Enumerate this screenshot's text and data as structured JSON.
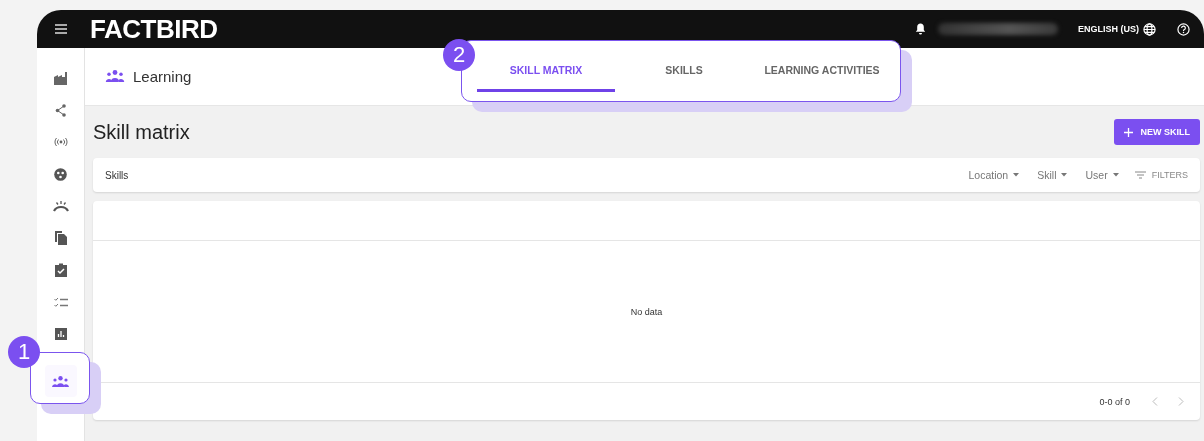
{
  "top_bar": {
    "logo": "FACTBIRD",
    "language": "ENGLISH (US)"
  },
  "sidebar": {
    "items": [
      {
        "kind": "factory",
        "selected": false
      },
      {
        "kind": "share",
        "selected": false
      },
      {
        "kind": "broadcast",
        "selected": false
      },
      {
        "kind": "circle-dots",
        "selected": false
      },
      {
        "kind": "alarm",
        "selected": false
      },
      {
        "kind": "documents",
        "selected": false
      },
      {
        "kind": "clipboard",
        "selected": false
      },
      {
        "kind": "checklist",
        "selected": false
      },
      {
        "kind": "chart",
        "selected": false
      },
      {
        "kind": "people",
        "selected": true
      }
    ]
  },
  "header": {
    "title": "Learning"
  },
  "tabs": [
    {
      "label": "SKILL MATRIX",
      "selected": true
    },
    {
      "label": "SKILLS",
      "selected": false
    },
    {
      "label": "LEARNING ACTIVITIES",
      "selected": false
    }
  ],
  "page": {
    "title": "Skill matrix",
    "new_button": "NEW SKILL"
  },
  "toolbar": {
    "label": "Skills",
    "dropdowns": [
      "Location",
      "Skill",
      "User"
    ],
    "filters": "FILTERS"
  },
  "table": {
    "empty_text": "No data",
    "pagination": "0-0 of 0"
  },
  "callouts": [
    {
      "number": "1"
    },
    {
      "number": "2"
    }
  ]
}
